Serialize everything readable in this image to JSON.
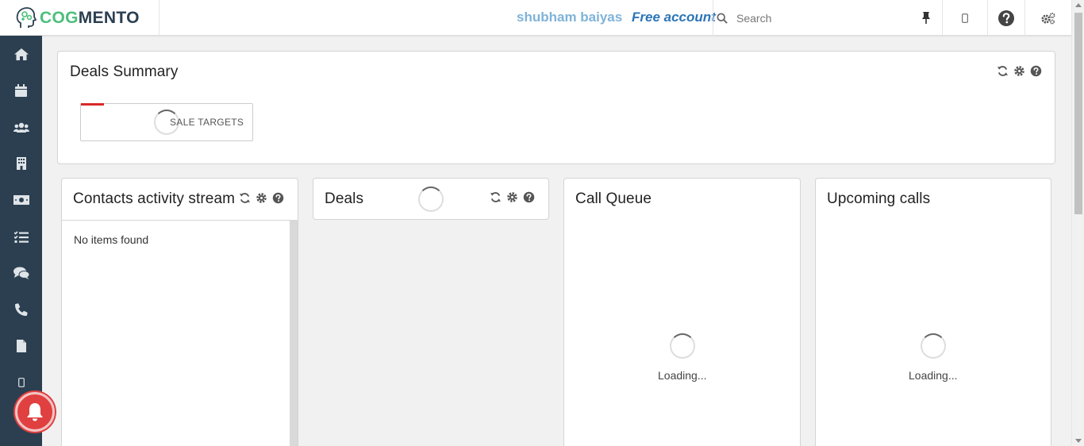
{
  "brand": {
    "logo_part1": "COG",
    "logo_part2": "MENTO",
    "accent_green": "#4cbf7b",
    "dark": "#2b3f50"
  },
  "header": {
    "user_name": "shubham baiyas",
    "account_type": "Free account",
    "search_placeholder": "Search",
    "icons": [
      "pin-icon",
      "mobile-icon",
      "help-icon",
      "settings-icon"
    ]
  },
  "sidebar": {
    "items": [
      {
        "icon": "home-icon"
      },
      {
        "icon": "calendar-icon"
      },
      {
        "icon": "contacts-icon"
      },
      {
        "icon": "companies-icon"
      },
      {
        "icon": "deals-money-icon"
      },
      {
        "icon": "tasks-icon"
      },
      {
        "icon": "chat-icon"
      },
      {
        "icon": "phone-icon"
      },
      {
        "icon": "document-icon"
      },
      {
        "icon": "mobile-icon"
      }
    ]
  },
  "deals_summary": {
    "title": "Deals Summary",
    "sale_targets_label": "SALE TARGETS"
  },
  "contacts_stream": {
    "title": "Contacts activity stream",
    "empty_text": "No items found"
  },
  "deals": {
    "title": "Deals"
  },
  "call_queue": {
    "title": "Call Queue",
    "loading_text": "Loading..."
  },
  "upcoming_calls": {
    "title": "Upcoming calls",
    "loading_text": "Loading..."
  },
  "colors": {
    "notification_red": "#e04040",
    "user_name_blue": "#7fb3d9",
    "account_blue": "#2c75b7"
  }
}
